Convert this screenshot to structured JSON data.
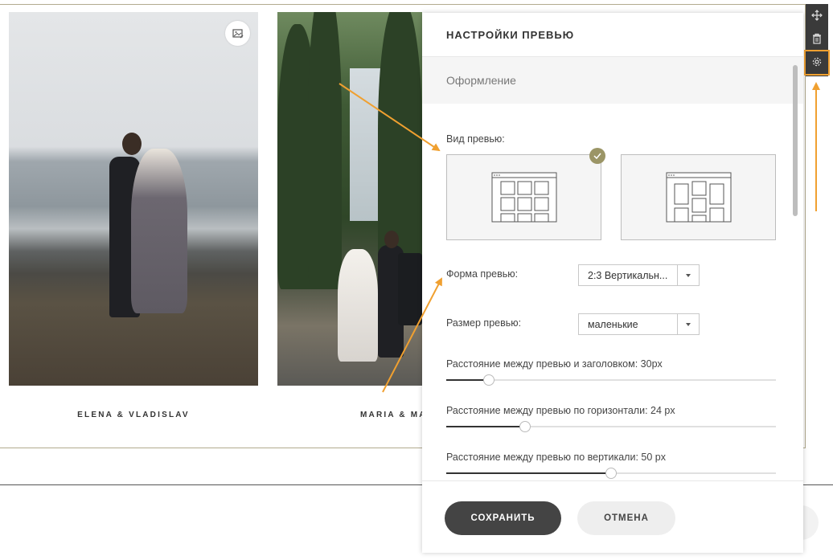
{
  "gallery": {
    "items": [
      {
        "caption": "ELENA & VLADISLAV"
      },
      {
        "caption": "MARIA & MA"
      }
    ]
  },
  "toolbar": {
    "icons": [
      "move-icon",
      "trash-icon",
      "gear-icon"
    ]
  },
  "panel": {
    "title": "НАСТРОЙКИ ПРЕВЬЮ",
    "section": "Оформление",
    "view": {
      "label": "Вид превью:",
      "options": [
        "grid-layout",
        "masonry-layout"
      ],
      "selected_index": 0
    },
    "shape": {
      "label": "Форма превью:",
      "value": "2:3 Вертикальн..."
    },
    "size": {
      "label": "Размер превью:",
      "value": "маленькие"
    },
    "sliders": [
      {
        "label": "Расстояние между превью и заголовком: 30px",
        "fraction": 0.13
      },
      {
        "label": "Расстояние между превью по горизонтали: 24 px",
        "fraction": 0.24
      },
      {
        "label": "Расстояние между превью по вертикали: 50 px",
        "fraction": 0.5
      }
    ],
    "buttons": {
      "save": "СОХРАНИТЬ",
      "cancel": "ОТМЕНА"
    }
  },
  "colors": {
    "accent": "#9b9566",
    "highlight": "#f0a030",
    "dark": "#444444"
  }
}
